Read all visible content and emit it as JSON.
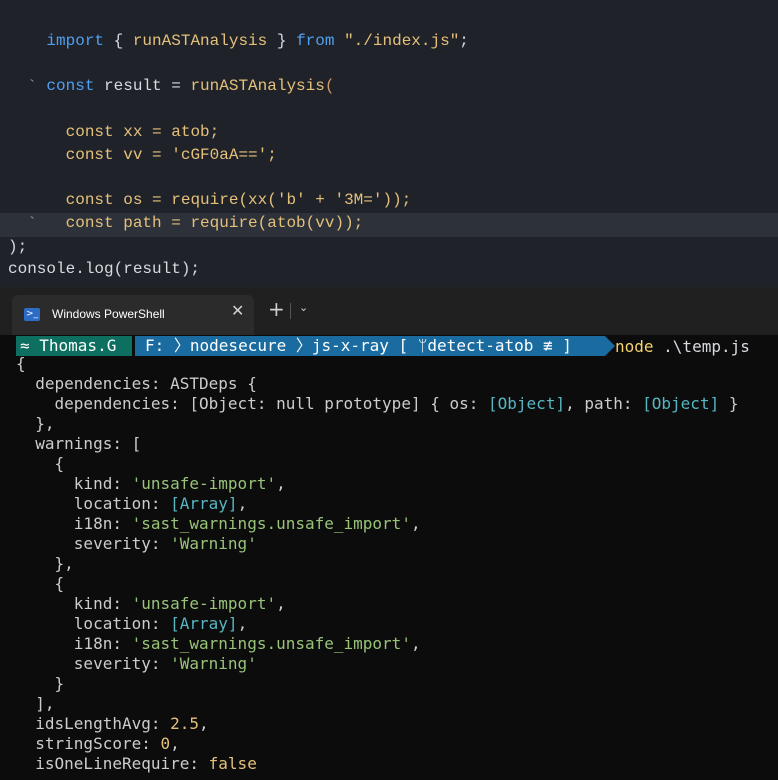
{
  "editor": {
    "lines": [
      {
        "kw": "import",
        "p1": " { ",
        "fn": "runASTAnalysis",
        "p2": " } ",
        "kw2": "from",
        "p3": " ",
        "str": "\"./index.js\"",
        "p4": ";"
      },
      {
        "kw": "const",
        "p1": " result = ",
        "fn": "runASTAnalysis",
        "br": "("
      },
      {
        "tick": "  `"
      },
      {
        "text1": "  ",
        "kw": "const",
        "fn": " xx = atob;"
      },
      {
        "text1": "  ",
        "kw": "const",
        "fn": " vv = 'cGF0aA==';"
      },
      {
        "text1": "  ",
        "kw": "const",
        "fn": " os = require(xx('b' + '3M='));"
      },
      {
        "text1": "  ",
        "kw": "const",
        "fn": " path = require(atob(vv));"
      },
      {
        "tick": "  `"
      },
      {
        "text": ");"
      },
      {
        "text": "console.log(result);"
      }
    ]
  },
  "terminal": {
    "tab_title": "Windows PowerShell",
    "tab_close": "✕",
    "tab_new": "+",
    "tab_menu": "⌄",
    "prompt": {
      "user": "≈ Thomas.G",
      "path": "F: 〉nodesecure 〉js-x-ray [ ᛘdetect-atob ≢ ]",
      "command": "node",
      "arg": " .\\temp.js"
    },
    "output": [
      "{",
      "  dependencies: ASTDeps {",
      "    dependencies: [Object: null prototype] { os: [Object], path: [Object] }",
      "  },",
      "  warnings: [",
      "    {",
      "      kind: 'unsafe-import',",
      "      location: [Array],",
      "      i18n: 'sast_warnings.unsafe_import',",
      "      severity: 'Warning'",
      "    },",
      "    {",
      "      kind: 'unsafe-import',",
      "      location: [Array],",
      "      i18n: 'sast_warnings.unsafe_import',",
      "      severity: 'Warning'",
      "    }",
      "  ],",
      "  idsLengthAvg: 2.5,",
      "  stringScore: 0,",
      "  isOneLineRequire: false"
    ]
  },
  "colors": {
    "keyword": "#4f9ff1",
    "function": "#e5c07b",
    "string": "#98c379",
    "link": "#56b6c2",
    "prompt_user_bg": "#0d6f5f",
    "prompt_path_bg": "#1a6b9f"
  }
}
